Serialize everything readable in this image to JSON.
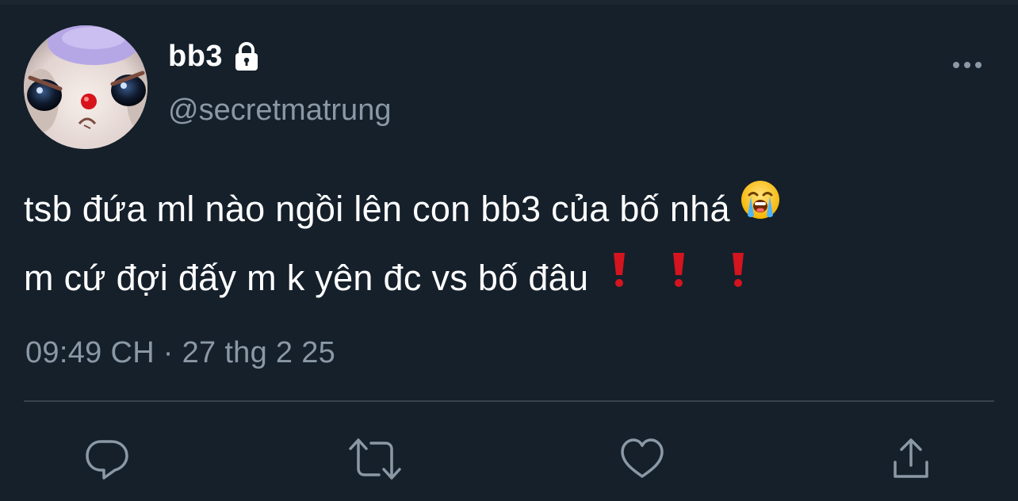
{
  "tweet": {
    "display_name": "bb3",
    "handle": "@secretmatrung",
    "text_lines": [
      "tsb đứa ml nào ngồi lên con bb3 của bố nhá",
      "m cứ đợi đấy m k yên đc vs bố đâu"
    ],
    "emoji_line1": "loudly-crying-face",
    "emoji_line2": [
      "heavy-exclamation-mark",
      "heavy-exclamation-mark",
      "heavy-exclamation-mark"
    ],
    "timestamp": "09:49 CH · 27 thg 2 25",
    "protected": true
  },
  "actions": {
    "reply_icon": "reply-icon",
    "retweet_icon": "retweet-icon",
    "like_icon": "heart-icon",
    "share_icon": "share-icon"
  },
  "colors": {
    "background": "#15202b",
    "primary_text": "#ffffff",
    "secondary_text": "#8b98a5",
    "divider": "#38444d",
    "icon": "#8b98a5",
    "exclamation_red": "#d4141e"
  }
}
